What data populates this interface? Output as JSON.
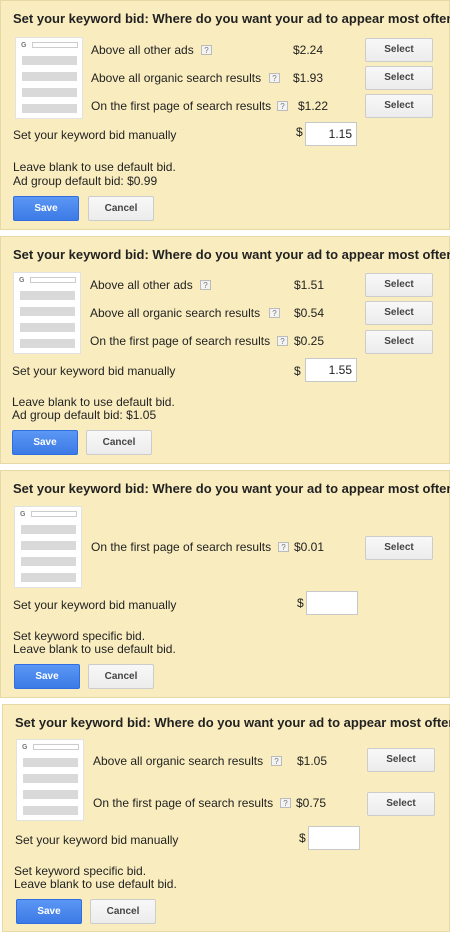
{
  "panels": [
    {
      "title": "Set your keyword bid: Where do you want your ad to appear most often?",
      "options": [
        {
          "label": "Above all other ads",
          "price": "$2.24",
          "select_label": "Select"
        },
        {
          "label": "Above all organic search results",
          "price": "$1.93",
          "select_label": "Select"
        },
        {
          "label": "On the first page of search results",
          "price": "$1.22",
          "select_label": "Select"
        }
      ],
      "manual_label": "Set your keyword bid manually",
      "currency": "$",
      "bid_value": "1.15",
      "note_line1": "Leave blank to use default bid.",
      "note_line2": "Ad group default bid: $0.99",
      "save_label": "Save",
      "cancel_label": "Cancel"
    },
    {
      "title": "Set your keyword bid: Where do you want your ad to appear most often?",
      "options": [
        {
          "label": "Above all other ads",
          "price": "$1.51",
          "select_label": "Select"
        },
        {
          "label": "Above all organic search results",
          "price": "$0.54",
          "select_label": "Select"
        },
        {
          "label": "On the first page of search results",
          "price": "$0.25",
          "select_label": "Select"
        }
      ],
      "manual_label": "Set your keyword bid manually",
      "currency": "$",
      "bid_value": "1.55",
      "note_line1": "Leave blank to use default bid.",
      "note_line2": "Ad group default bid: $1.05",
      "save_label": "Save",
      "cancel_label": "Cancel"
    },
    {
      "title": "Set your keyword bid: Where do you want your ad to appear most often?",
      "options": [
        {
          "label": "On the first page of search results",
          "price": "$0.01",
          "select_label": "Select"
        }
      ],
      "manual_label": "Set your keyword bid manually",
      "currency": "$",
      "bid_value": "",
      "note_line1": "Set keyword specific bid.",
      "note_line2": "Leave blank to use default bid.",
      "save_label": "Save",
      "cancel_label": "Cancel"
    },
    {
      "title": "Set your keyword bid: Where do you want your ad to appear most often?",
      "options": [
        {
          "label": "Above all organic search results",
          "price": "$1.05",
          "select_label": "Select"
        },
        {
          "label": "On the first page of search results",
          "price": "$0.75",
          "select_label": "Select"
        }
      ],
      "manual_label": "Set your keyword bid manually",
      "currency": "$",
      "bid_value": "",
      "note_line1": "Set keyword specific bid.",
      "note_line2": "Leave blank to use default bid.",
      "save_label": "Save",
      "cancel_label": "Cancel"
    }
  ],
  "help_icon": "help-question-icon",
  "colors": {
    "panel_bg": "#f9edbf",
    "save_button": "#3c7ae6",
    "thumb_line": "#d9d9d9"
  }
}
